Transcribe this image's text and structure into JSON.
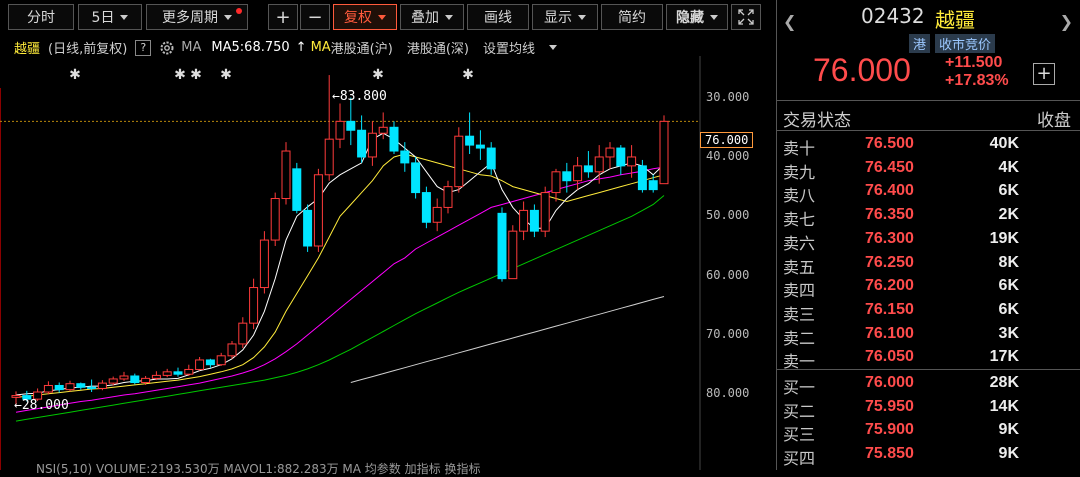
{
  "toolbar": {
    "fenshi": "分时",
    "period": "5日",
    "more_period": "更多周期",
    "plus": "+",
    "minus": "−",
    "fuquan": "复权",
    "diejia": "叠加",
    "huaxian": "画线",
    "xianshi": "显示",
    "jianyue": "简约",
    "yincang": "隐藏"
  },
  "info": {
    "name": "越疆",
    "period_label": "(日线,前复权)",
    "help": "?",
    "ma_label": "MA",
    "ma5": "MA5:68.750",
    "ma_tag": "MA",
    "hk_connect_sh": "港股通(沪)",
    "hk_connect_sz": "港股通(深)",
    "set_ma": "设置均线"
  },
  "chart": {
    "high_label": "←83.800",
    "low_label": "←28.000",
    "current_price_label": "76.000",
    "yticks": [
      "80.000",
      "70.000",
      "60.000",
      "50.000",
      "40.000",
      "30.000"
    ],
    "footer": "NSI(5,10)   VOLUME:2193.530万   MAVOL1:882.283万   MA   均参数   加指标   换指标"
  },
  "chart_data": {
    "type": "candlestick",
    "ylim": [
      24,
      86
    ],
    "yticks": [
      30,
      40,
      50,
      60,
      70,
      80
    ],
    "last_price": 76.0,
    "high_marker": 83.8,
    "low_marker": 28.0,
    "candles": [
      [
        29.5,
        29.8,
        28.0,
        30.5
      ],
      [
        29.8,
        29.2,
        28.8,
        30.6
      ],
      [
        29.2,
        30.4,
        28.9,
        31.0
      ],
      [
        30.4,
        31.5,
        30.0,
        32.2
      ],
      [
        31.5,
        30.8,
        30.3,
        32.0
      ],
      [
        30.8,
        31.8,
        30.5,
        32.3
      ],
      [
        31.8,
        31.2,
        30.8,
        32.0
      ],
      [
        31.2,
        31.0,
        30.4,
        32.5
      ],
      [
        31.0,
        31.9,
        30.7,
        32.4
      ],
      [
        31.9,
        32.6,
        31.5,
        33.0
      ],
      [
        32.6,
        33.1,
        32.3,
        33.8
      ],
      [
        33.1,
        32.0,
        31.7,
        33.5
      ],
      [
        32.0,
        32.7,
        31.6,
        33.1
      ],
      [
        32.7,
        33.2,
        32.4,
        33.9
      ],
      [
        33.2,
        33.8,
        32.9,
        34.3
      ],
      [
        33.8,
        33.4,
        33.0,
        34.5
      ],
      [
        33.4,
        34.2,
        33.1,
        35.0
      ],
      [
        34.2,
        35.8,
        34.0,
        36.3
      ],
      [
        35.8,
        35.0,
        34.5,
        36.0
      ],
      [
        35.0,
        36.5,
        34.8,
        37.0
      ],
      [
        36.5,
        38.5,
        36.0,
        39.0
      ],
      [
        38.5,
        42.0,
        37.8,
        43.0
      ],
      [
        42.0,
        48.0,
        41.0,
        49.5
      ],
      [
        48.0,
        56.0,
        47.0,
        57.5
      ],
      [
        56.0,
        63.0,
        55.0,
        64.0
      ],
      [
        63.0,
        71.0,
        62.0,
        72.5
      ],
      [
        68.0,
        61.0,
        60.5,
        69.0
      ],
      [
        61.0,
        55.0,
        54.0,
        62.0
      ],
      [
        55.0,
        67.0,
        54.0,
        68.0
      ],
      [
        67.0,
        73.0,
        66.0,
        83.8
      ],
      [
        73.0,
        76.0,
        71.5,
        79.0
      ],
      [
        76.0,
        74.5,
        72.0,
        80.0
      ],
      [
        74.5,
        70.0,
        69.0,
        77.0
      ],
      [
        70.0,
        74.0,
        68.5,
        76.0
      ],
      [
        74.0,
        75.0,
        73.0,
        77.5
      ],
      [
        75.0,
        71.0,
        70.5,
        76.0
      ],
      [
        71.0,
        69.0,
        67.5,
        72.5
      ],
      [
        69.0,
        64.0,
        63.0,
        70.0
      ],
      [
        64.0,
        59.0,
        58.0,
        65.0
      ],
      [
        59.0,
        61.5,
        57.5,
        63.0
      ],
      [
        61.5,
        65.0,
        60.5,
        66.0
      ],
      [
        65.0,
        73.5,
        64.0,
        75.0
      ],
      [
        73.5,
        72.0,
        70.5,
        77.5
      ],
      [
        72.0,
        71.5,
        69.5,
        74.5
      ],
      [
        71.5,
        68.0,
        67.0,
        72.5
      ],
      [
        60.5,
        49.5,
        49.0,
        61.5
      ],
      [
        49.5,
        57.5,
        52.0,
        58.5
      ],
      [
        57.5,
        61.0,
        56.0,
        62.5
      ],
      [
        61.0,
        57.5,
        56.5,
        62.0
      ],
      [
        57.5,
        64.0,
        56.5,
        65.0
      ],
      [
        64.0,
        67.5,
        62.5,
        68.0
      ],
      [
        67.5,
        66.0,
        64.0,
        69.0
      ],
      [
        66.0,
        68.5,
        64.5,
        70.0
      ],
      [
        68.5,
        67.5,
        66.5,
        71.0
      ],
      [
        67.5,
        70.0,
        65.5,
        72.0
      ],
      [
        70.0,
        71.5,
        68.0,
        72.5
      ],
      [
        71.5,
        68.5,
        67.0,
        72.0
      ],
      [
        68.5,
        70.0,
        66.5,
        72.0
      ],
      [
        68.5,
        64.5,
        64.0,
        69.5
      ],
      [
        66.0,
        64.5,
        64.0,
        67.0
      ],
      [
        65.5,
        76.0,
        65.5,
        77.0
      ]
    ],
    "ma5": [
      29.9,
      30.1,
      30.2,
      30.6,
      30.8,
      31.1,
      31.2,
      31.4,
      31.4,
      31.6,
      32.0,
      32.2,
      32.3,
      32.6,
      32.6,
      32.7,
      33.3,
      34.0,
      34.4,
      35.0,
      36.0,
      37.5,
      40.0,
      44.0,
      49.5,
      56.0,
      60.0,
      61.6,
      63.0,
      65.6,
      67.0,
      68.0,
      69.0,
      73.0,
      74.0,
      73.0,
      71.5,
      70.0,
      67.5,
      65.0,
      64.0,
      64.5,
      66.0,
      67.5,
      69.0,
      64.5,
      61.5,
      59.5,
      58.0,
      58.0,
      61.0,
      63.0,
      64.5,
      65.5,
      67.0,
      68.0,
      68.5,
      69.0,
      68.5,
      67.0,
      68.75
    ],
    "ma10": [
      29.5,
      29.7,
      29.9,
      30.1,
      30.3,
      30.5,
      30.7,
      30.9,
      31.0,
      31.2,
      31.4,
      31.6,
      31.8,
      32.0,
      32.2,
      32.4,
      32.7,
      33.0,
      33.4,
      33.8,
      34.3,
      35.0,
      36.2,
      38.0,
      40.5,
      44.0,
      47.0,
      50.0,
      53.0,
      56.5,
      60.0,
      62.0,
      64.0,
      66.0,
      68.5,
      70.0,
      70.5,
      70.0,
      69.5,
      69.0,
      68.5,
      68.0,
      67.5,
      67.0,
      66.8,
      66.0,
      65.0,
      64.5,
      64.0,
      63.5,
      63.0,
      62.5,
      63.0,
      63.5,
      64.0,
      64.5,
      65.0,
      65.5,
      66.0,
      66.5,
      67.0
    ],
    "ma20": [
      27.0,
      27.3,
      27.6,
      27.9,
      28.2,
      28.5,
      28.8,
      29.0,
      29.3,
      29.6,
      29.9,
      30.1,
      30.4,
      30.7,
      31.0,
      31.3,
      31.6,
      31.9,
      32.3,
      32.7,
      33.1,
      33.6,
      34.2,
      35.0,
      36.0,
      37.2,
      38.5,
      40.0,
      41.5,
      43.0,
      44.5,
      46.0,
      47.5,
      49.0,
      50.5,
      52.0,
      53.0,
      54.5,
      55.5,
      56.5,
      57.5,
      58.5,
      59.5,
      60.5,
      61.5,
      62.0,
      62.5,
      63.0,
      63.5,
      64.0,
      64.5,
      65.0,
      65.5,
      66.0,
      66.3,
      66.6,
      67.0,
      67.3,
      67.6,
      68.0,
      68.3
    ],
    "ma60": [
      25.5,
      25.8,
      26.1,
      26.4,
      26.7,
      27.0,
      27.3,
      27.6,
      27.9,
      28.2,
      28.5,
      28.8,
      29.1,
      29.4,
      29.7,
      30.0,
      30.3,
      30.6,
      30.9,
      31.2,
      31.5,
      31.8,
      32.1,
      32.4,
      32.8,
      33.2,
      33.7,
      34.3,
      35.0,
      35.8,
      36.7,
      37.6,
      38.6,
      39.6,
      40.6,
      41.6,
      42.6,
      43.6,
      44.5,
      45.4,
      46.3,
      47.2,
      48.0,
      48.8,
      49.6,
      50.4,
      51.2,
      52.0,
      52.8,
      53.6,
      54.4,
      55.2,
      56.0,
      56.8,
      57.6,
      58.4,
      59.2,
      60.0,
      61.0,
      62.0,
      63.5
    ],
    "ma120": [
      null,
      null,
      null,
      null,
      null,
      null,
      null,
      null,
      null,
      null,
      null,
      null,
      null,
      null,
      null,
      null,
      null,
      null,
      null,
      null,
      null,
      null,
      null,
      null,
      null,
      null,
      null,
      null,
      null,
      null,
      null,
      32.0,
      32.5,
      33.0,
      33.5,
      34.0,
      34.5,
      35.0,
      35.5,
      36.0,
      36.5,
      37.0,
      37.5,
      38.0,
      38.5,
      39.0,
      39.5,
      40.0,
      40.5,
      41.0,
      41.5,
      42.0,
      42.5,
      43.0,
      43.5,
      44.0,
      44.5,
      45.0,
      45.5,
      46.0,
      46.5
    ],
    "colors": {
      "up": "#ff3b3b",
      "down": "#00e5ff",
      "ma5": "#ffffff",
      "ma10": "#ffeb3b",
      "ma20": "#ff00ff",
      "ma60": "#00c800",
      "ma120": "#d0d0d0"
    }
  },
  "right_panel": {
    "code": "02432",
    "name": "越疆",
    "market_tag": "港",
    "session_tag": "收市竞价",
    "price": "76.000",
    "change": "+11.500",
    "change_pct": "+17.83%",
    "add": "+",
    "status_label": "交易状态",
    "status_value": "收盘",
    "asks": [
      {
        "label": "卖十",
        "price": "76.500",
        "vol": "40K"
      },
      {
        "label": "卖九",
        "price": "76.450",
        "vol": "4K"
      },
      {
        "label": "卖八",
        "price": "76.400",
        "vol": "6K"
      },
      {
        "label": "卖七",
        "price": "76.350",
        "vol": "2K"
      },
      {
        "label": "卖六",
        "price": "76.300",
        "vol": "19K"
      },
      {
        "label": "卖五",
        "price": "76.250",
        "vol": "8K"
      },
      {
        "label": "卖四",
        "price": "76.200",
        "vol": "6K"
      },
      {
        "label": "卖三",
        "price": "76.150",
        "vol": "6K"
      },
      {
        "label": "卖二",
        "price": "76.100",
        "vol": "3K"
      },
      {
        "label": "卖一",
        "price": "76.050",
        "vol": "17K"
      }
    ],
    "bids": [
      {
        "label": "买一",
        "price": "76.000",
        "vol": "28K"
      },
      {
        "label": "买二",
        "price": "75.950",
        "vol": "14K"
      },
      {
        "label": "买三",
        "price": "75.900",
        "vol": "9K"
      },
      {
        "label": "买四",
        "price": "75.850",
        "vol": "9K"
      }
    ]
  }
}
